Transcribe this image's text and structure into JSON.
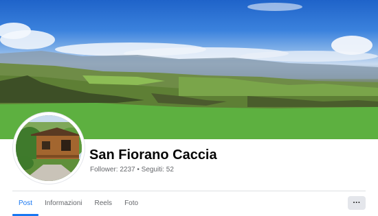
{
  "page": {
    "name": "San Fiorano Caccia",
    "stats": "Follower: 2237 • Seguiti: 52"
  },
  "tabs": [
    {
      "label": "Post",
      "active": true
    },
    {
      "label": "Informazioni",
      "active": false
    },
    {
      "label": "Reels",
      "active": false
    },
    {
      "label": "Foto",
      "active": false
    }
  ],
  "more_button": {
    "label": "···",
    "icon": "more-dots-icon"
  },
  "colors": {
    "accent": "#1877f2",
    "secondary_text": "#65676b",
    "button_bg": "#e4e6eb"
  }
}
